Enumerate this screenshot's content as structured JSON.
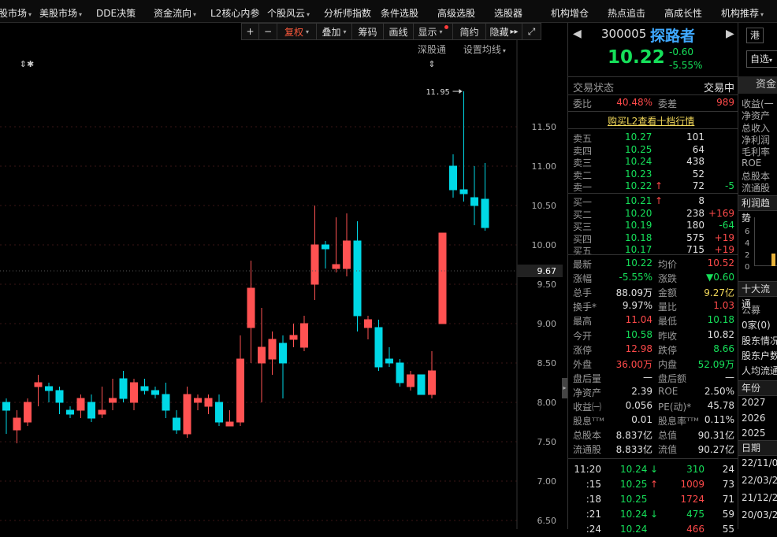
{
  "menu": [
    {
      "label": "股市场",
      "dd": true
    },
    {
      "label": "美股市场",
      "dd": true
    },
    {
      "label": "DDE决策",
      "dd": false
    },
    {
      "label": "资金流向",
      "dd": true
    },
    {
      "label": "L2核心内参",
      "dd": false
    },
    {
      "label": "个股风云",
      "dd": true
    },
    {
      "label": "分析师指数",
      "dd": false
    },
    {
      "label": "条件选股",
      "dd": false
    },
    {
      "label": "高级选股",
      "dd": false
    },
    {
      "label": "选股器",
      "dd": false
    },
    {
      "label": "机构增仓",
      "dd": false
    },
    {
      "label": "热点追击",
      "dd": false
    },
    {
      "label": "高成长性",
      "dd": false
    },
    {
      "label": "机构推荐",
      "dd": true
    }
  ],
  "toolbar": {
    "plus": "+",
    "minus": "−",
    "fuquan": "复权",
    "diejia": "叠加",
    "chouma": "筹码",
    "huaxian": "画线",
    "xianshi": "显示",
    "jianyue": "简约",
    "yincang": "隐藏",
    "yincang_arrows": "▸▸",
    "expand": "⤢"
  },
  "chart_head": {
    "shentong": "深股通",
    "junxian": "设置均线"
  },
  "chart_data": {
    "type": "candlestick",
    "ylim": [
      6.5,
      12.2
    ],
    "yticks": [
      "11.50",
      "11.00",
      "10.50",
      "10.00",
      "9.50",
      "9.00",
      "8.50",
      "8.00",
      "7.50",
      "7.00",
      "6.50"
    ],
    "ytick_values": [
      11.5,
      11.0,
      10.5,
      10.0,
      9.5,
      9.0,
      8.5,
      8.0,
      7.5,
      7.0,
      6.5
    ],
    "current_price_tag": "9.67",
    "current_price": 9.67,
    "high_marker": "11.95",
    "high_value": 11.95,
    "candles": [
      {
        "o": 8.0,
        "c": 7.9,
        "h": 8.05,
        "l": 7.6
      },
      {
        "o": 7.65,
        "c": 7.8,
        "h": 7.9,
        "l": 7.48
      },
      {
        "o": 7.75,
        "c": 8.0,
        "h": 8.05,
        "l": 7.7
      },
      {
        "o": 8.2,
        "c": 8.25,
        "h": 8.35,
        "l": 7.95
      },
      {
        "o": 8.2,
        "c": 8.15,
        "h": 8.25,
        "l": 8.0
      },
      {
        "o": 8.15,
        "c": 8.0,
        "h": 8.2,
        "l": 7.85
      },
      {
        "o": 7.9,
        "c": 7.85,
        "h": 7.95,
        "l": 7.8
      },
      {
        "o": 7.9,
        "c": 8.05,
        "h": 8.1,
        "l": 7.8
      },
      {
        "o": 8.0,
        "c": 7.8,
        "h": 8.1,
        "l": 7.75
      },
      {
        "o": 7.85,
        "c": 7.9,
        "h": 8.2,
        "l": 7.8
      },
      {
        "o": 8.0,
        "c": 8.05,
        "h": 8.3,
        "l": 7.9
      },
      {
        "o": 8.3,
        "c": 8.05,
        "h": 8.4,
        "l": 8.0
      },
      {
        "o": 8.0,
        "c": 8.25,
        "h": 8.3,
        "l": 7.9
      },
      {
        "o": 8.2,
        "c": 8.15,
        "h": 8.3,
        "l": 8.1
      },
      {
        "o": 8.15,
        "c": 8.1,
        "h": 8.2,
        "l": 8.05
      },
      {
        "o": 8.1,
        "c": 7.9,
        "h": 8.25,
        "l": 7.8
      },
      {
        "o": 7.8,
        "c": 7.65,
        "h": 7.9,
        "l": 7.6
      },
      {
        "o": 7.6,
        "c": 8.1,
        "h": 8.2,
        "l": 7.55
      },
      {
        "o": 8.0,
        "c": 8.05,
        "h": 8.1,
        "l": 7.9
      },
      {
        "o": 7.95,
        "c": 8.05,
        "h": 8.1,
        "l": 7.85
      },
      {
        "o": 8.0,
        "c": 7.75,
        "h": 8.1,
        "l": 7.7
      },
      {
        "o": 7.7,
        "c": 7.75,
        "h": 7.9,
        "l": 7.7
      },
      {
        "o": 7.75,
        "c": 8.55,
        "h": 8.85,
        "l": 7.7
      },
      {
        "o": 8.95,
        "c": 9.45,
        "h": 9.8,
        "l": 8.5
      },
      {
        "o": 8.5,
        "c": 8.7,
        "h": 9.2,
        "l": 8.0
      },
      {
        "o": 8.55,
        "c": 8.8,
        "h": 8.9,
        "l": 8.35
      },
      {
        "o": 8.75,
        "c": 8.5,
        "h": 8.85,
        "l": 8.05
      },
      {
        "o": 8.8,
        "c": 8.85,
        "h": 9.0,
        "l": 8.7
      },
      {
        "o": 8.7,
        "c": 9.0,
        "h": 9.1,
        "l": 8.65
      },
      {
        "o": 9.5,
        "c": 10.0,
        "h": 10.5,
        "l": 9.3
      },
      {
        "o": 10.0,
        "c": 9.95,
        "h": 10.05,
        "l": 9.7
      },
      {
        "o": 9.7,
        "c": 9.75,
        "h": 10.35,
        "l": 9.65
      },
      {
        "o": 9.7,
        "c": 10.05,
        "h": 10.4,
        "l": 9.6
      },
      {
        "o": 10.05,
        "c": 9.1,
        "h": 10.3,
        "l": 8.9
      },
      {
        "o": 8.95,
        "c": 9.05,
        "h": 9.1,
        "l": 8.8
      },
      {
        "o": 8.95,
        "c": 8.45,
        "h": 9.05,
        "l": 8.4
      },
      {
        "o": 8.55,
        "c": 8.5,
        "h": 8.7,
        "l": 8.45
      },
      {
        "o": 8.5,
        "c": 8.25,
        "h": 8.55,
        "l": 8.2
      },
      {
        "o": 8.2,
        "c": 8.35,
        "h": 8.4,
        "l": 8.15
      },
      {
        "o": 8.35,
        "c": 8.1,
        "h": 8.35,
        "l": 8.1
      },
      {
        "o": 8.1,
        "c": 8.4,
        "h": 8.65,
        "l": 8.05
      },
      {
        "o": 9.0,
        "c": 10.15,
        "h": 10.15,
        "l": 9.0
      },
      {
        "o": 11.0,
        "c": 10.7,
        "h": 11.15,
        "l": 10.6
      },
      {
        "o": 10.7,
        "c": 10.65,
        "h": 11.95,
        "l": 10.55
      },
      {
        "o": 10.6,
        "c": 10.5,
        "h": 11.0,
        "l": 10.25
      },
      {
        "o": 10.58,
        "c": 10.22,
        "h": 11.04,
        "l": 10.18
      }
    ],
    "marks": [
      {
        "candle": 0,
        "text": "⇕✱"
      },
      {
        "candle": 40,
        "text": "⇕"
      }
    ]
  },
  "quote": {
    "code": "300005",
    "name": "探路者",
    "tag": "港",
    "price": "10.22",
    "change": "-0.60",
    "change_pct": "-5.55%"
  },
  "trade_status": {
    "label": "交易状态",
    "value": "交易中"
  },
  "ratio": {
    "wb_label": "委比",
    "wb_value": "40.48%",
    "wc_label": "委差",
    "wc_value": "989"
  },
  "l2_link": "购买L2查看十档行情",
  "asks": [
    {
      "label": "卖五",
      "price": "10.27",
      "vol": "101",
      "chg": ""
    },
    {
      "label": "卖四",
      "price": "10.25",
      "vol": "64",
      "chg": ""
    },
    {
      "label": "卖三",
      "price": "10.24",
      "vol": "438",
      "chg": ""
    },
    {
      "label": "卖二",
      "price": "10.23",
      "vol": "52",
      "chg": ""
    },
    {
      "label": "卖一",
      "price": "10.22",
      "vol": "72",
      "chg": "-5",
      "up": true
    }
  ],
  "bids": [
    {
      "label": "买一",
      "price": "10.21",
      "vol": "8",
      "chg": "",
      "up": true
    },
    {
      "label": "买二",
      "price": "10.20",
      "vol": "238",
      "chg": "+169"
    },
    {
      "label": "买三",
      "price": "10.19",
      "vol": "180",
      "chg": "-64"
    },
    {
      "label": "买四",
      "price": "10.18",
      "vol": "575",
      "chg": "+19"
    },
    {
      "label": "买五",
      "price": "10.17",
      "vol": "715",
      "chg": "+19"
    }
  ],
  "stats": [
    {
      "l1": "最新",
      "v1": "10.22",
      "c1": "green",
      "l2": "均价",
      "v2": "10.52",
      "c2": "red"
    },
    {
      "l1": "涨幅",
      "v1": "-5.55%",
      "c1": "green",
      "l2": "涨跌",
      "v2": "▼0.60",
      "c2": "green"
    },
    {
      "l1": "总手",
      "v1": "88.09万",
      "c1": "white",
      "l2": "金额",
      "v2": "9.27亿",
      "c2": "yellow"
    },
    {
      "l1": "换手*",
      "v1": "9.97%",
      "c1": "white",
      "l2": "量比",
      "v2": "1.03",
      "c2": "red"
    },
    {
      "l1": "最高",
      "v1": "11.04",
      "c1": "red",
      "l2": "最低",
      "v2": "10.18",
      "c2": "green"
    },
    {
      "l1": "今开",
      "v1": "10.58",
      "c1": "green",
      "l2": "昨收",
      "v2": "10.82",
      "c2": "white"
    },
    {
      "l1": "涨停",
      "v1": "12.98",
      "c1": "red",
      "l2": "跌停",
      "v2": "8.66",
      "c2": "green"
    },
    {
      "l1": "外盘",
      "v1": "36.00万",
      "c1": "red",
      "l2": "内盘",
      "v2": "52.09万",
      "c2": "green"
    },
    {
      "l1": "盘后量",
      "v1": "—",
      "c1": "white",
      "l2": "盘后额",
      "v2": "—",
      "c2": "white"
    },
    {
      "l1": "净资产",
      "v1": "2.39",
      "c1": "white",
      "l2": "ROE",
      "v2": "2.50%",
      "c2": "white"
    },
    {
      "l1": "收益㈠",
      "v1": "0.056",
      "c1": "white",
      "l2": "PE(动)*",
      "v2": "45.78",
      "c2": "white"
    },
    {
      "l1": "股息ᵀᵀᴹ",
      "v1": "0.01",
      "c1": "white",
      "l2": "股息率ᵀᵀᴹ",
      "v2": "0.11%",
      "c2": "white"
    },
    {
      "l1": "总股本",
      "v1": "8.837亿",
      "c1": "white",
      "l2": "总值",
      "v2": "90.31亿",
      "c2": "white"
    },
    {
      "l1": "流通股",
      "v1": "8.833亿",
      "c1": "white",
      "l2": "流值",
      "v2": "90.27亿",
      "c2": "white"
    }
  ],
  "ticks": [
    {
      "time": "11:20",
      "price": "10.24",
      "dir": "down",
      "vol": "310",
      "n": "24"
    },
    {
      "time": ":15",
      "price": "10.25",
      "dir": "up",
      "vol": "1009",
      "n": "73"
    },
    {
      "time": ":18",
      "price": "10.25",
      "dir": "",
      "vol": "1724",
      "n": "71"
    },
    {
      "time": ":21",
      "price": "10.24",
      "dir": "down",
      "vol": "475",
      "n": "59"
    },
    {
      "time": ":24",
      "price": "10.24",
      "dir": "",
      "vol": "466",
      "n": "55"
    }
  ],
  "far": {
    "zixuan": "自选",
    "zijin": "资金",
    "fin_labels": [
      "收益(一",
      "净资产",
      "总收入",
      "净利润",
      "毛利率",
      "ROE",
      "总股本",
      "流通股"
    ],
    "trend_title": "利润趋势",
    "trend_axis": [
      "8",
      "6",
      "4",
      "2",
      "0"
    ],
    "top10": "十大流通",
    "gongmu": "公募",
    "jia": "0家(0)",
    "holder_labels": [
      "股东情况",
      "股东户数",
      "人均流通"
    ],
    "years_title": "年份",
    "years": [
      "2027",
      "2026",
      "2025"
    ],
    "date_title": "日期",
    "dates": [
      "22/11/0",
      "22/03/2",
      "21/12/2",
      "20/03/2"
    ]
  }
}
